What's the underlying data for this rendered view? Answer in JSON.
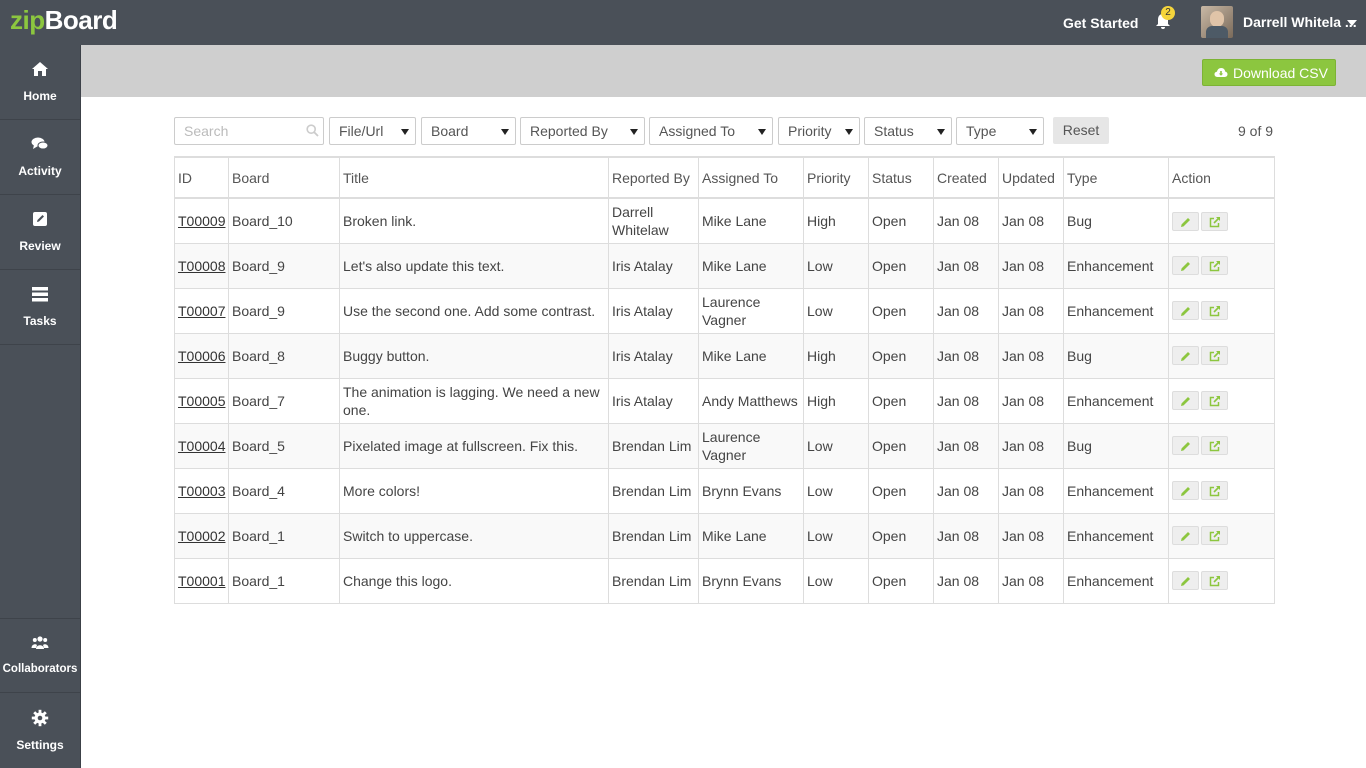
{
  "app": {
    "logo_zip": "zip",
    "logo_board": "Board",
    "get_started": "Get Started",
    "notification_count": "2",
    "user_name": "Darrell Whitela ...",
    "accent_color": "#8cc63f"
  },
  "sidebar": {
    "items": [
      {
        "label": "Home",
        "icon": "home-icon"
      },
      {
        "label": "Activity",
        "icon": "chat-icon"
      },
      {
        "label": "Review",
        "icon": "edit-icon"
      },
      {
        "label": "Tasks",
        "icon": "tasks-icon"
      }
    ],
    "bottom_items": [
      {
        "label": "Collaborators",
        "icon": "users-icon"
      },
      {
        "label": "Settings",
        "icon": "gear-icon"
      }
    ]
  },
  "toolbar": {
    "download_csv": "Download CSV"
  },
  "filters": {
    "search_placeholder": "Search",
    "file_url": "File/Url",
    "board": "Board",
    "reported_by": "Reported By",
    "assigned_to": "Assigned To",
    "priority": "Priority",
    "status": "Status",
    "type": "Type",
    "reset": "Reset",
    "count": "9 of 9"
  },
  "table": {
    "headers": [
      "ID",
      "Board",
      "Title",
      "Reported By",
      "Assigned To",
      "Priority",
      "Status",
      "Created",
      "Updated",
      "Type",
      "Action"
    ],
    "rows": [
      {
        "id": "T00009",
        "board": "Board_10",
        "title": "Broken link.",
        "reported_by": "Darrell Whitelaw",
        "assigned_to": "Mike Lane",
        "priority": "High",
        "status": "Open",
        "created": "Jan 08",
        "updated": "Jan 08",
        "type": "Bug"
      },
      {
        "id": "T00008",
        "board": "Board_9",
        "title": "Let's also update this text.",
        "reported_by": "Iris Atalay",
        "assigned_to": "Mike Lane",
        "priority": "Low",
        "status": "Open",
        "created": "Jan 08",
        "updated": "Jan 08",
        "type": "Enhancement"
      },
      {
        "id": "T00007",
        "board": "Board_9",
        "title": "Use the second one. Add some contrast.",
        "reported_by": "Iris Atalay",
        "assigned_to": "Laurence Vagner",
        "priority": "Low",
        "status": "Open",
        "created": "Jan 08",
        "updated": "Jan 08",
        "type": "Enhancement"
      },
      {
        "id": "T00006",
        "board": "Board_8",
        "title": "Buggy button.",
        "reported_by": "Iris Atalay",
        "assigned_to": "Mike Lane",
        "priority": "High",
        "status": "Open",
        "created": "Jan 08",
        "updated": "Jan 08",
        "type": "Bug"
      },
      {
        "id": "T00005",
        "board": "Board_7",
        "title": "The animation is lagging. We need a new one.",
        "reported_by": "Iris Atalay",
        "assigned_to": "Andy Matthews",
        "priority": "High",
        "status": "Open",
        "created": "Jan 08",
        "updated": "Jan 08",
        "type": "Enhancement"
      },
      {
        "id": "T00004",
        "board": "Board_5",
        "title": "Pixelated image at fullscreen. Fix this.",
        "reported_by": "Brendan Lim",
        "assigned_to": "Laurence Vagner",
        "priority": "Low",
        "status": "Open",
        "created": "Jan 08",
        "updated": "Jan 08",
        "type": "Bug"
      },
      {
        "id": "T00003",
        "board": "Board_4",
        "title": "More colors!",
        "reported_by": "Brendan Lim",
        "assigned_to": "Brynn Evans",
        "priority": "Low",
        "status": "Open",
        "created": "Jan 08",
        "updated": "Jan 08",
        "type": "Enhancement"
      },
      {
        "id": "T00002",
        "board": "Board_1",
        "title": "Switch to uppercase.",
        "reported_by": "Brendan Lim",
        "assigned_to": "Mike Lane",
        "priority": "Low",
        "status": "Open",
        "created": "Jan 08",
        "updated": "Jan 08",
        "type": "Enhancement"
      },
      {
        "id": "T00001",
        "board": "Board_1",
        "title": "Change this logo.",
        "reported_by": "Brendan Lim",
        "assigned_to": "Brynn Evans",
        "priority": "Low",
        "status": "Open",
        "created": "Jan 08",
        "updated": "Jan 08",
        "type": "Enhancement"
      }
    ]
  }
}
